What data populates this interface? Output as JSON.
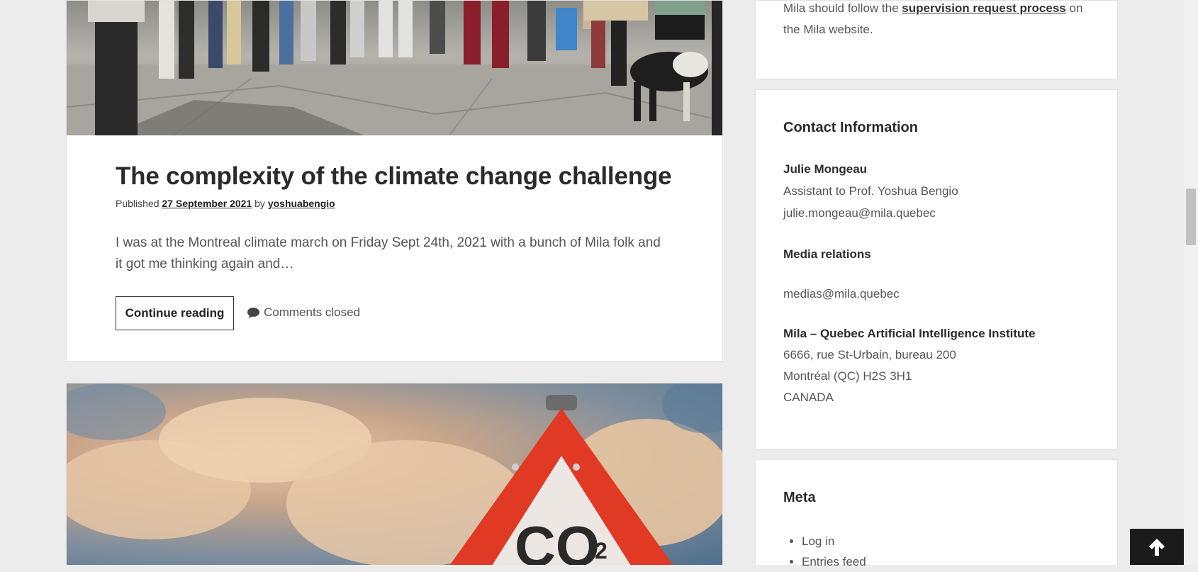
{
  "post1": {
    "title": "The complexity of the climate change challenge",
    "meta_published": "Published",
    "meta_date": "27 September 2021",
    "meta_by": "by",
    "meta_author": "yoshuabengio",
    "excerpt": "I was at the Montreal climate march on Friday Sept 24th, 2021 with a bunch of Mila folk and it got me thinking again and…",
    "continue_label": "Continue reading",
    "comments_label": "Comments closed",
    "comments_icon": "speech-bubble-icon"
  },
  "post2": {
    "sign_text": "CO",
    "sign_subscript": "2"
  },
  "sidebar": {
    "top_widget": {
      "text_before": "Mila should follow the",
      "link": "supervision request process",
      "text_after_line1": "on",
      "text_line2": "the Mila website."
    },
    "contact": {
      "title": "Contact Information",
      "name": "Julie Mongeau",
      "role": "Assistant to Prof. Yoshua Bengio",
      "email": "julie.mongeau@mila.quebec",
      "media_title": "Media relations",
      "media_email": "medias@mila.quebec",
      "org_name": "Mila – Quebec Artificial Intelligence Institute",
      "address1": "6666, rue St-Urbain, bureau 200",
      "address2": "Montréal (QC) H2S 3H1",
      "country": "CANADA"
    },
    "meta": {
      "title": "Meta",
      "items": [
        "Log in",
        "Entries feed"
      ]
    }
  },
  "back_to_top_icon": "arrow-up-icon"
}
